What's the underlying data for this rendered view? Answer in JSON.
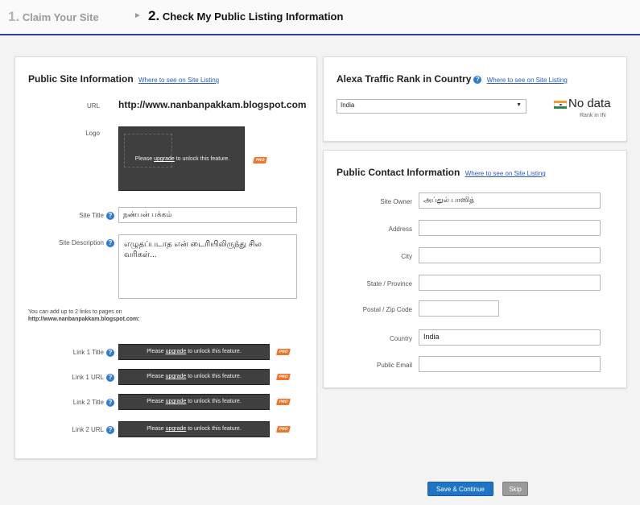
{
  "steps": {
    "step1_num": "1.",
    "step1_label": "Claim Your Site",
    "arrow": "►",
    "step2_num": "2.",
    "step2_label": "Check My Public Listing Information"
  },
  "public_site": {
    "title": "Public Site Information",
    "where_link": "Where to see on Site Listing",
    "url_label": "URL",
    "url_value": "http://www.nanbanpakkam.blogspot.com",
    "logo_label": "Logo",
    "locked": {
      "before": "Please",
      "link": "upgrade",
      "after": "to unlock this feature."
    },
    "pro_badge": "PRO",
    "site_title_label": "Site Title",
    "site_title_value": "நண்பன் பக்கம்",
    "site_desc_label": "Site Description",
    "site_desc_value": "எழுதப்படாத என் டைரியிலிருந்து சில வரிகள்...",
    "links_note_1": "You can add up to 2 links to pages on",
    "links_note_2": "http://www.nanbanpakkam.blogspot.com:",
    "link_rows": [
      {
        "label": "Link 1 Title"
      },
      {
        "label": "Link 1 URL"
      },
      {
        "label": "Link 2 Title"
      },
      {
        "label": "Link 2 URL"
      }
    ]
  },
  "alexa": {
    "title": "Alexa Traffic Rank in Country",
    "where_link": "Where to see on Site Listing",
    "country_selected": "India",
    "no_data": "No data",
    "rank_in": "Rank in IN"
  },
  "contact": {
    "title": "Public Contact Information",
    "where_link": "Where to see on Site Listing",
    "fields": [
      {
        "label": "Site Owner",
        "value": "அப்துல் பாஸித்"
      },
      {
        "label": "Address",
        "value": ""
      },
      {
        "label": "City",
        "value": ""
      },
      {
        "label": "State / Province",
        "value": ""
      },
      {
        "label": "Postal / Zip Code",
        "value": ""
      },
      {
        "label": "Country",
        "value": "India"
      },
      {
        "label": "Public Email",
        "value": ""
      }
    ]
  },
  "buttons": {
    "save": "Save & Continue",
    "skip": "Skip"
  },
  "colors": {
    "accent": "#2c3f8f",
    "link": "#2a5db0",
    "save_button": "#1f74c6",
    "pro_badge": "#f0772a"
  }
}
